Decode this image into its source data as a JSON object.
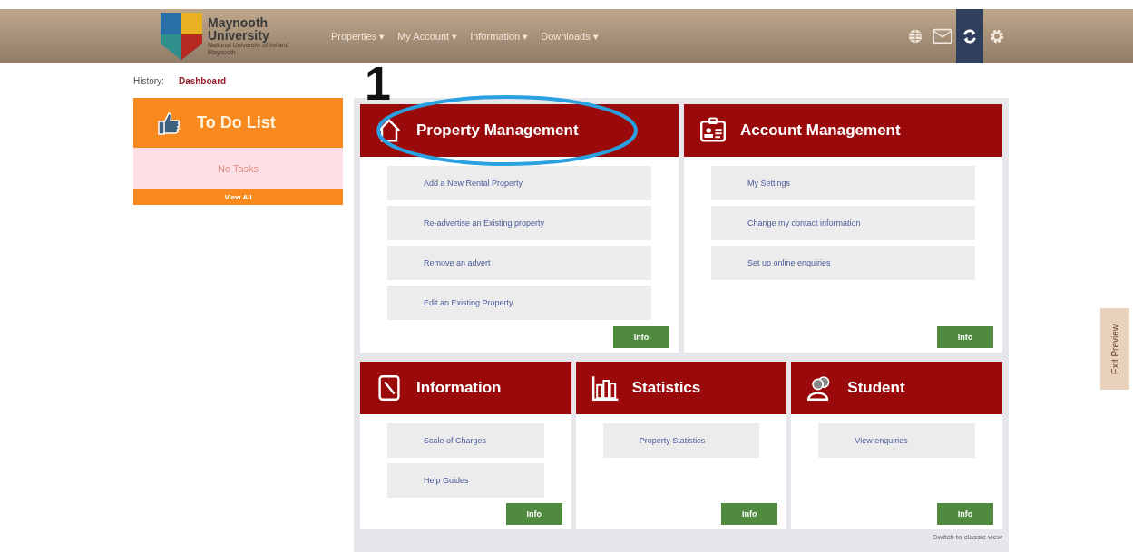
{
  "logo": {
    "title": "Maynooth",
    "subtitle": "University",
    "tagline": "National University of Ireland Maynooth"
  },
  "nav": [
    {
      "label": "Properties",
      "arrow": "▾"
    },
    {
      "label": "My Account",
      "arrow": "▾"
    },
    {
      "label": "Information",
      "arrow": "▾"
    },
    {
      "label": "Downloads",
      "arrow": "▾"
    }
  ],
  "header_icons": [
    {
      "kind": "globe",
      "selected": false
    },
    {
      "kind": "mail",
      "selected": false
    },
    {
      "kind": "sync",
      "selected": true
    },
    {
      "kind": "gear",
      "selected": false
    }
  ],
  "history": {
    "label": "History:",
    "link": "Dashboard"
  },
  "todo": {
    "title": "To Do List",
    "empty": "No Tasks",
    "view_all": "View All"
  },
  "annotation": {
    "number": "1"
  },
  "top_cards": [
    {
      "kind": "house",
      "title": "Property Management",
      "items": [
        "Add a New Rental Property",
        "Re-advertise an Existing property",
        "Remove an advert",
        "Edit an Existing Property"
      ],
      "button": "Info"
    },
    {
      "kind": "badge",
      "title": "Account Management",
      "items": [
        "My Settings",
        "Change my contact information",
        "Set up online enquiries"
      ],
      "button": "Info"
    }
  ],
  "bottom_cards": [
    {
      "kind": "document",
      "title": "Information",
      "items": [
        "Scale of Charges",
        "Help Guides"
      ],
      "button": "Info"
    },
    {
      "kind": "chart",
      "title": "Statistics",
      "items": [
        "Property Statistics"
      ],
      "button": "Info"
    },
    {
      "kind": "people",
      "title": "Student",
      "items": [
        "View enquiries"
      ],
      "button": "Info"
    }
  ],
  "footer_link": "Switch to classic view",
  "side_tab": "Exit Preview"
}
